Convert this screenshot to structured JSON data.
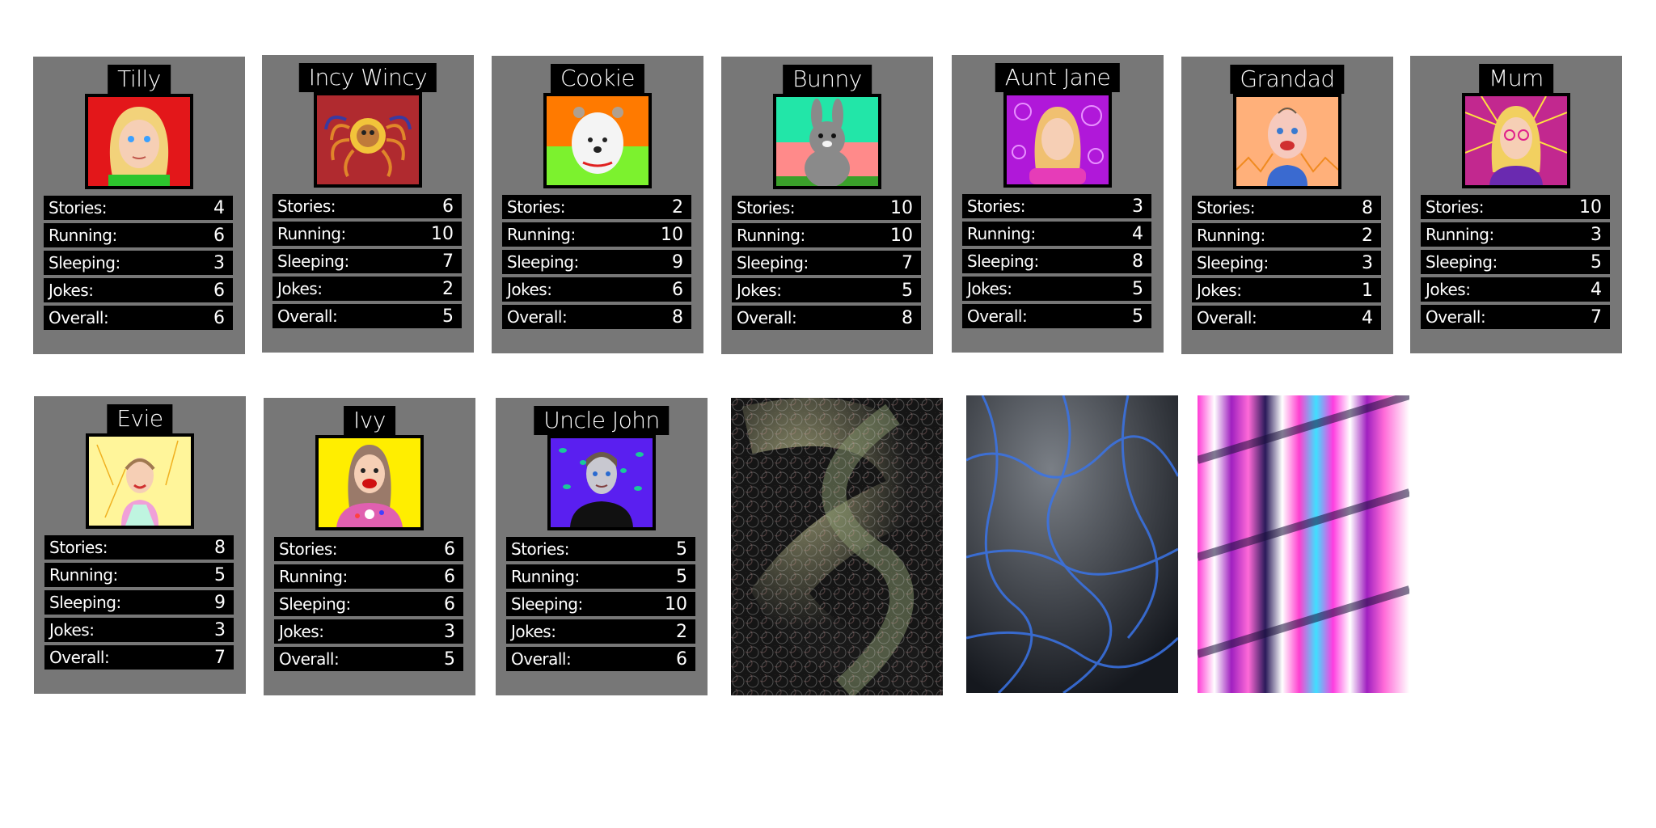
{
  "labels": {
    "stories": "Stories:",
    "running": "Running:",
    "sleeping": "Sleeping:",
    "jokes": "Jokes:",
    "overall": "Overall:"
  },
  "cards": [
    {
      "name": "Tilly",
      "bg": "#e3171a",
      "stats": {
        "stories": "4",
        "running": "6",
        "sleeping": "3",
        "jokes": "6",
        "overall": "6"
      }
    },
    {
      "name": "Incy Wincy",
      "bg": "#b02a2f",
      "stats": {
        "stories": "6",
        "running": "10",
        "sleeping": "7",
        "jokes": "2",
        "overall": "5"
      }
    },
    {
      "name": "Cookie",
      "bg": "#ff7a00",
      "stats": {
        "stories": "2",
        "running": "10",
        "sleeping": "9",
        "jokes": "6",
        "overall": "8"
      }
    },
    {
      "name": "Bunny",
      "bg": "#22e6a8",
      "stats": {
        "stories": "10",
        "running": "10",
        "sleeping": "7",
        "jokes": "5",
        "overall": "8"
      }
    },
    {
      "name": "Aunt Jane",
      "bg": "#b018d9",
      "stats": {
        "stories": "3",
        "running": "4",
        "sleeping": "8",
        "jokes": "5",
        "overall": "5"
      }
    },
    {
      "name": "Grandad",
      "bg": "#ffb07a",
      "stats": {
        "stories": "8",
        "running": "2",
        "sleeping": "3",
        "jokes": "1",
        "overall": "4"
      }
    },
    {
      "name": "Mum",
      "bg": "#c2288f",
      "stats": {
        "stories": "10",
        "running": "3",
        "sleeping": "5",
        "jokes": "4",
        "overall": "7"
      }
    },
    {
      "name": "Evie",
      "bg": "#fff59a",
      "stats": {
        "stories": "8",
        "running": "5",
        "sleeping": "9",
        "jokes": "3",
        "overall": "7"
      }
    },
    {
      "name": "Ivy",
      "bg": "#ffee00",
      "stats": {
        "stories": "6",
        "running": "6",
        "sleeping": "6",
        "jokes": "3",
        "overall": "5"
      }
    },
    {
      "name": "Uncle John",
      "bg": "#5a1ff0",
      "stats": {
        "stories": "5",
        "running": "5",
        "sleeping": "10",
        "jokes": "2",
        "overall": "6"
      }
    }
  ]
}
